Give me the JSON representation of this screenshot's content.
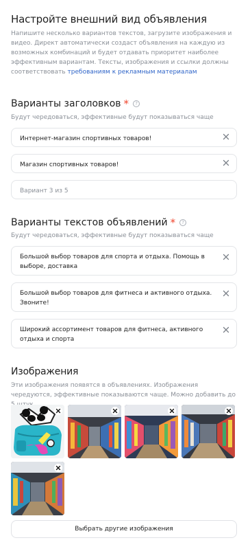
{
  "header": {
    "title": "Настройте внешний вид объявления",
    "description": "Напишите несколько вариантов текстов, загрузите изображения и видео. Директ автоматически создаст объявления на каждую из возможных комбинаций и будет отдавать приоритет наиболее эффективным вариантам. Тексты, изображения и ссылки должны соответствовать ",
    "requirements_link": "требованиям к рекламным материалам"
  },
  "headlines": {
    "title": "Варианты заголовков",
    "required_mark": "*",
    "help": "?",
    "hint": "Будут чередоваться, эффективные будут показываться чаще",
    "items": [
      {
        "value": "Интернет-магазин спортивных товаров!"
      },
      {
        "value": "Магазин спортивных товаров!"
      }
    ],
    "placeholder": "Вариант 3 из 5"
  },
  "texts": {
    "title": "Варианты текстов объявлений",
    "required_mark": "*",
    "help": "?",
    "hint": "Будут чередоваться, эффективные будут показываться чаще",
    "items": [
      {
        "value": "Большой выбор товаров для спорта и отдыха. Помощь в выборе, доставка"
      },
      {
        "value": "Большой выбор товаров для фитнеса и активного отдыха. Звоните!"
      },
      {
        "value": "Широкий ассортимент товаров для фитнеса, активного отдыха и спорта"
      }
    ]
  },
  "images": {
    "title": "Изображения",
    "hint": "Эти изображения появятся в объявлениях. Изображения чередуются, эффективные показываются чаще. Можно добавить до 5 штук",
    "items": [
      {
        "name": "panda-bag-image"
      },
      {
        "name": "store-aisle-image-1"
      },
      {
        "name": "store-aisle-image-2"
      },
      {
        "name": "store-aisle-image-3"
      },
      {
        "name": "store-aisle-image-4"
      }
    ],
    "choose_button": "Выбрать другие изображения"
  },
  "colors": {
    "accent_link": "#2e64c8",
    "required": "#f0452d",
    "hint": "#8a8f97",
    "border": "#e3e5e8"
  }
}
